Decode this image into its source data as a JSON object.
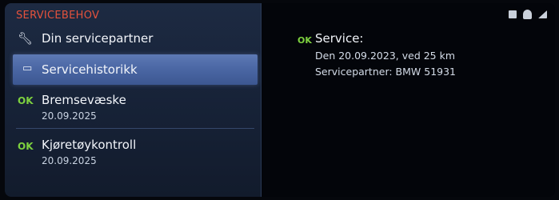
{
  "menu": {
    "title": "SERVICEBEHOV",
    "items": [
      {
        "label": "Din servicepartner",
        "icon": "wrench-icon"
      },
      {
        "label": "Servicehistorikk",
        "icon": "service-book-icon",
        "selected": true
      },
      {
        "status": "OK",
        "label": "Bremsevæske",
        "date": "20.09.2025"
      },
      {
        "status": "OK",
        "label": "Kjøretøykontroll",
        "date": "20.09.2025"
      }
    ]
  },
  "detail": {
    "status": "OK",
    "title": "Service:",
    "line1": "Den 20.09.2023, ved 25 km",
    "line2": "Servicepartner: BMW 51931"
  },
  "status_bar": {
    "icons": [
      "phone-icon",
      "person-icon",
      "signal-icon"
    ]
  },
  "colors": {
    "title_red": "#e5523c",
    "ok_green": "#7dd13f",
    "selection_blue": "#4a66a3"
  }
}
